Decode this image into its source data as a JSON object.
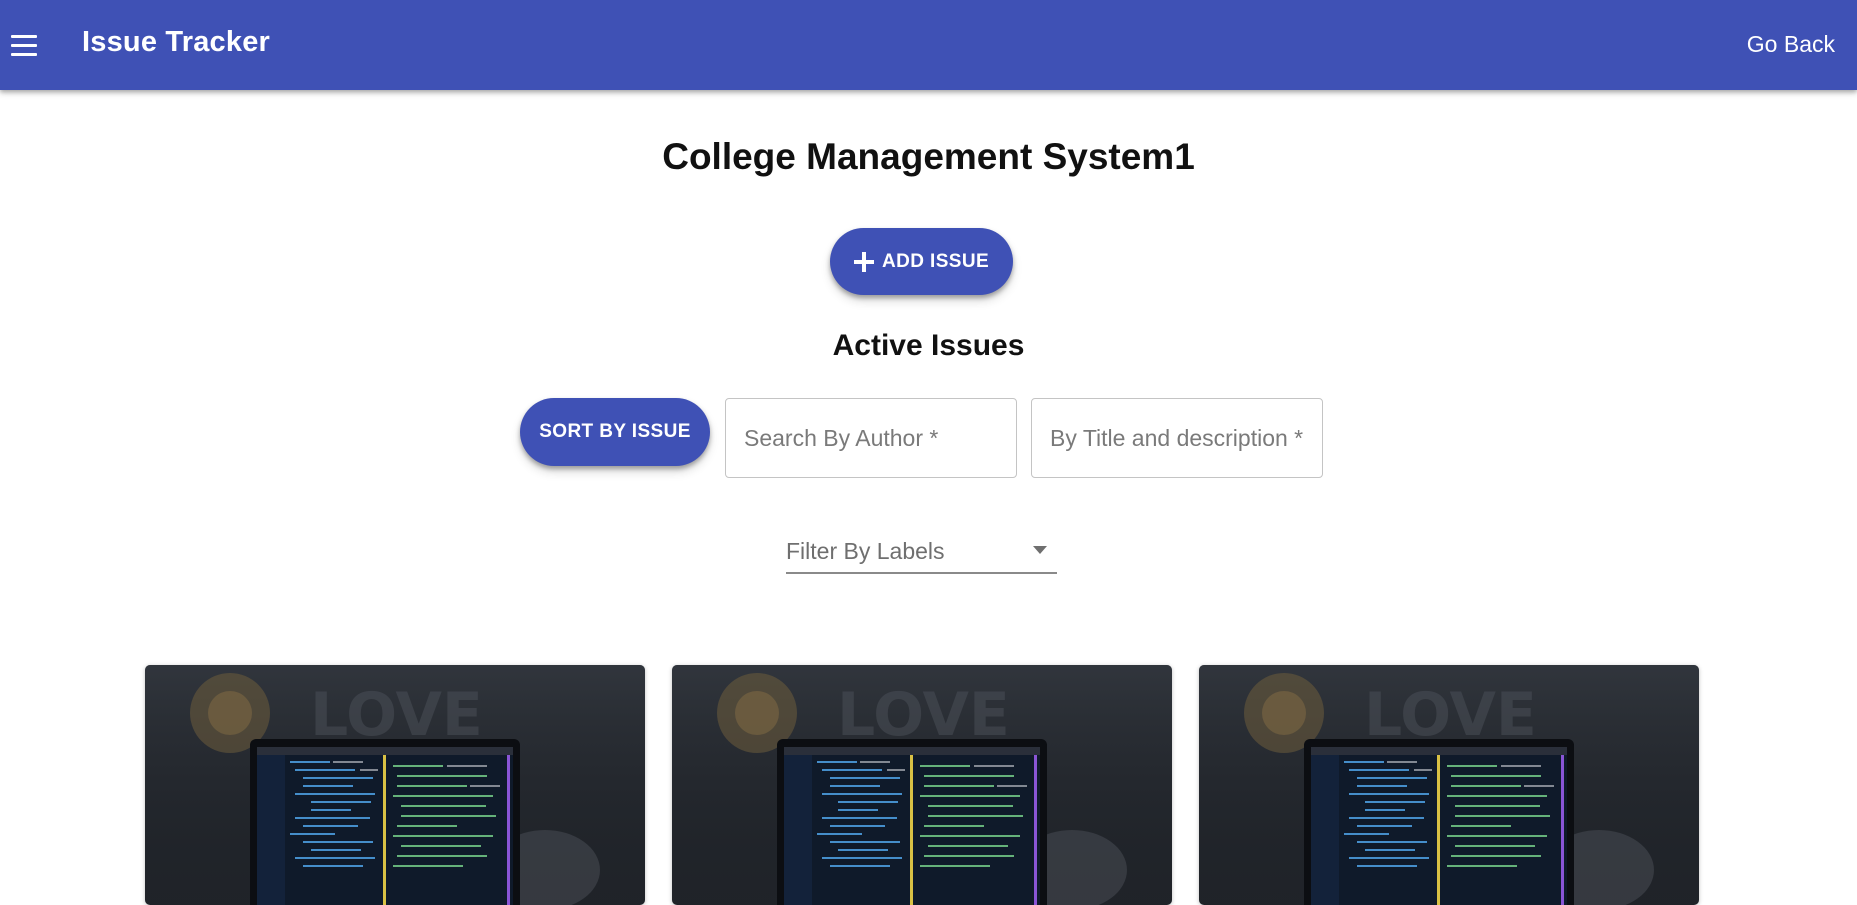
{
  "appbar": {
    "menu_icon": "hamburger-menu-icon",
    "title": "Issue Tracker",
    "go_back_label": "Go Back"
  },
  "project": {
    "title": "College Management System1"
  },
  "add_issue": {
    "label": "ADD ISSUE",
    "icon": "plus-icon"
  },
  "active_issues": {
    "heading": "Active Issues",
    "sort_label": "SORT BY ISSUE",
    "search_author_placeholder": "Search By Author *",
    "search_title_placeholder": "By Title and description *",
    "filter_label": "Filter By Labels",
    "filter_icon": "dropdown-caret-icon"
  },
  "cards": [
    {
      "image": "laptop-code-photo"
    },
    {
      "image": "laptop-code-photo"
    },
    {
      "image": "laptop-code-photo"
    }
  ],
  "colors": {
    "primary": "#3f51b5",
    "on_primary": "#ffffff",
    "text": "#111111",
    "muted": "#6f6f6f"
  }
}
